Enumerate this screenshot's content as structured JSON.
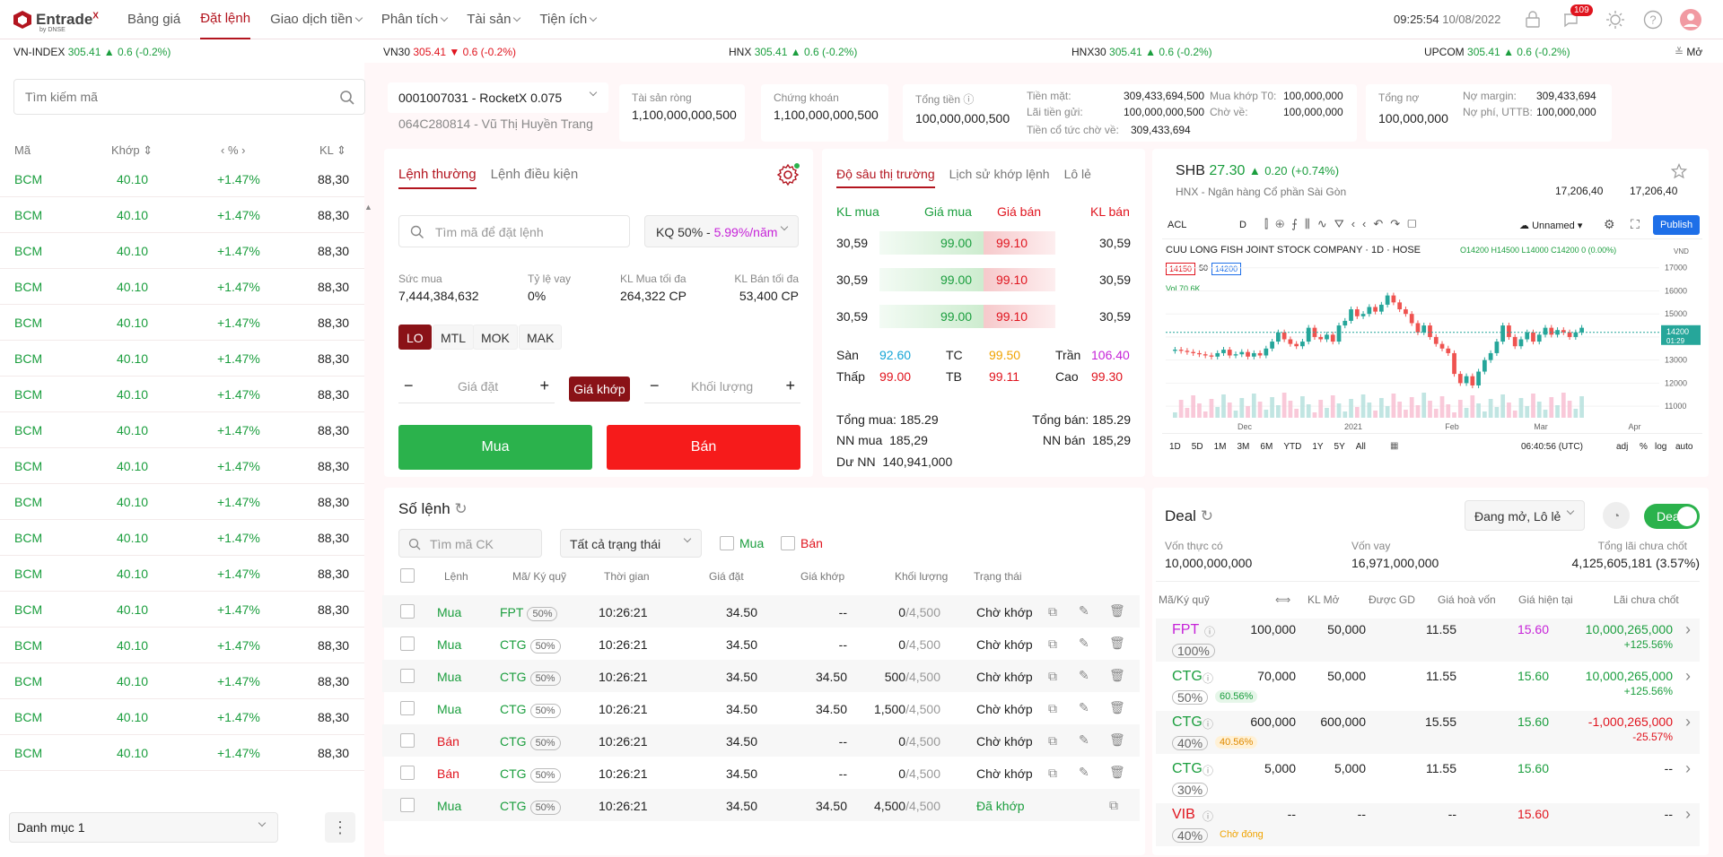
{
  "topbar": {
    "brand": "Entrade",
    "brand_sup": "X",
    "brand_sub": "by DNSE",
    "nav": [
      {
        "label": "Bảng giá",
        "active": false,
        "dropdown": false
      },
      {
        "label": "Đặt lệnh",
        "active": true,
        "dropdown": false
      },
      {
        "label": "Giao dịch tiền",
        "active": false,
        "dropdown": true
      },
      {
        "label": "Phân tích",
        "active": false,
        "dropdown": true
      },
      {
        "label": "Tài sản",
        "active": false,
        "dropdown": true
      },
      {
        "label": "Tiện ích",
        "active": false,
        "dropdown": true
      }
    ],
    "time": "09:25:54",
    "date": "10/08/2022",
    "notif_count": "109",
    "icons": [
      "otp-icon",
      "notification-icon",
      "theme-icon",
      "help-icon",
      "user-avatar-icon"
    ]
  },
  "indices": [
    {
      "name": "VN-INDEX",
      "value": "305.41",
      "change": "0.6 (-0.2%)"
    },
    {
      "name": "VN30",
      "value": "305.41",
      "change": "0.6 (-0.2%)"
    },
    {
      "name": "HNX",
      "value": "305.41",
      "change": "0.6 (-0.2%)"
    },
    {
      "name": "HNX30",
      "value": "305.41",
      "change": "0.6 (-0.2%)"
    },
    {
      "name": "UPCOM",
      "value": "305.41",
      "change": "0.6 (-0.2%)"
    }
  ],
  "indices_more": "Mở",
  "watchlist": {
    "search_placeholder": "Tìm kiếm mã",
    "columns": [
      "Mã",
      "Khớp",
      "%",
      "KL"
    ],
    "rows": [
      {
        "code": "BCM",
        "price": "40.10",
        "pct": "+1.47%",
        "vol": "88,30"
      },
      {
        "code": "BCM",
        "price": "40.10",
        "pct": "+1.47%",
        "vol": "88,30"
      },
      {
        "code": "BCM",
        "price": "40.10",
        "pct": "+1.47%",
        "vol": "88,30"
      },
      {
        "code": "BCM",
        "price": "40.10",
        "pct": "+1.47%",
        "vol": "88,30"
      },
      {
        "code": "BCM",
        "price": "40.10",
        "pct": "+1.47%",
        "vol": "88,30"
      },
      {
        "code": "BCM",
        "price": "40.10",
        "pct": "+1.47%",
        "vol": "88,30"
      },
      {
        "code": "BCM",
        "price": "40.10",
        "pct": "+1.47%",
        "vol": "88,30"
      },
      {
        "code": "BCM",
        "price": "40.10",
        "pct": "+1.47%",
        "vol": "88,30"
      },
      {
        "code": "BCM",
        "price": "40.10",
        "pct": "+1.47%",
        "vol": "88,30"
      },
      {
        "code": "BCM",
        "price": "40.10",
        "pct": "+1.47%",
        "vol": "88,30"
      },
      {
        "code": "BCM",
        "price": "40.10",
        "pct": "+1.47%",
        "vol": "88,30"
      },
      {
        "code": "BCM",
        "price": "40.10",
        "pct": "+1.47%",
        "vol": "88,30"
      },
      {
        "code": "BCM",
        "price": "40.10",
        "pct": "+1.47%",
        "vol": "88,30"
      },
      {
        "code": "BCM",
        "price": "40.10",
        "pct": "+1.47%",
        "vol": "88,30"
      },
      {
        "code": "BCM",
        "price": "40.10",
        "pct": "+1.47%",
        "vol": "88,30"
      },
      {
        "code": "BCM",
        "price": "40.10",
        "pct": "+1.47%",
        "vol": "88,30"
      },
      {
        "code": "BCM",
        "price": "40.10",
        "pct": "+1.47%",
        "vol": "88,30"
      }
    ],
    "list_name": "Danh mục 1"
  },
  "account": {
    "id": "0001007031 - RocketX 0.075",
    "sub": "064C280814 - Vũ Thị Huyền Trang",
    "tai_san_rong_label": "Tài sản ròng",
    "tai_san_rong": "1,100,000,000,500",
    "chung_khoan_label": "Chứng khoán",
    "chung_khoan": "1,100,000,000,500",
    "tong_tien_label": "Tổng tiền",
    "tong_tien": "100,000,000,500",
    "tien_mat_label": "Tiền mặt:",
    "tien_mat": "309,433,694,500",
    "lai_tien_gui_label": "Lãi tiền gửi:",
    "lai_tien_gui": "100,000,000,500",
    "tien_co_tuc_label": "Tiền cổ tức chờ về:",
    "tien_co_tuc": "309,433,694",
    "mua_khop_label": "Mua khớp T0:",
    "mua_khop": "100,000,000",
    "cho_ve_label": "Chờ về:",
    "cho_ve": "100,000,000",
    "tong_no_label": "Tổng nợ",
    "tong_no": "100,000,000",
    "no_margin_label": "Nợ margin:",
    "no_margin": "309,433,694",
    "no_phi_label": "Nợ phí, UTTB:",
    "no_phi": "100,000,000"
  },
  "order": {
    "tabs": [
      "Lệnh thường",
      "Lệnh điều kiện"
    ],
    "search_placeholder": "Tìm mã để đặt lệnh",
    "kq": "KQ 50% - ",
    "kq_rate": "5.99%/năm",
    "suc_mua_label": "Sức mua",
    "suc_mua": "7,444,384,632",
    "ty_le_vay_label": "Tỷ lệ vay",
    "ty_le_vay": "0%",
    "kl_mua_label": "KL Mua tối đa",
    "kl_mua": "264,322 CP",
    "kl_ban_label": "KL Bán tối đa",
    "kl_ban": "53,400 CP",
    "types": [
      "LO",
      "MTL",
      "MOK",
      "MAK"
    ],
    "price_placeholder": "Giá đặt",
    "gia_khop": "Giá khớp",
    "qty_placeholder": "Khối lượng",
    "buy": "Mua",
    "sell": "Bán"
  },
  "depth": {
    "tabs": [
      "Độ sâu thị trường",
      "Lịch sử khớp lệnh",
      "Lô lẻ"
    ],
    "headers": [
      "KL mua",
      "Giá mua",
      "Giá bán",
      "KL bán"
    ],
    "rows": [
      {
        "kl_mua": "30,59",
        "gia_mua": "99.00",
        "gia_ban": "99.10",
        "kl_ban": "30,59"
      },
      {
        "kl_mua": "30,59",
        "gia_mua": "99.00",
        "gia_ban": "99.10",
        "kl_ban": "30,59"
      },
      {
        "kl_mua": "30,59",
        "gia_mua": "99.00",
        "gia_ban": "99.10",
        "kl_ban": "30,59"
      }
    ],
    "san_label": "Sàn",
    "san": "92.60",
    "tc_label": "TC",
    "tc": "99.50",
    "tran_label": "Trần",
    "tran": "106.40",
    "thap_label": "Thấp",
    "thap": "99.00",
    "tb_label": "TB",
    "tb": "99.11",
    "cao_label": "Cao",
    "cao": "99.30",
    "tong_mua": "Tổng mua: 185.29",
    "tong_ban": "Tổng bán: 185.29",
    "nn_mua": "NN mua  185,29",
    "nn_ban": "NN bán  185,29",
    "du_nn": "Dư NN  140,941,000"
  },
  "stock": {
    "code": "SHB",
    "price": "27.30",
    "change": "0.20",
    "pct": "(+0.74%)",
    "name": "HNX - Ngân hàng Cổ phần Sài Gòn",
    "v1": "17,206,40",
    "v2": "17,206,40"
  },
  "chart": {
    "toolbar": [
      "ACL",
      "D",
      "Unnamed",
      "Publish"
    ],
    "title": "CUU LONG FISH JOINT STOCK COMPANY · 1D · HOSE",
    "ohlc": "O14200 H14500 L14000 C14200 0 (0.00%)",
    "tags": [
      "14150",
      "50",
      "14200"
    ],
    "vol": "Vol  70.6K",
    "ranges": [
      "1D",
      "5D",
      "1M",
      "3M",
      "6M",
      "YTD",
      "1Y",
      "5Y",
      "All"
    ],
    "time": "06:40:56 (UTC)",
    "opts": [
      "adj",
      "%",
      "log",
      "auto"
    ],
    "months": [
      "Dec",
      "2021",
      "Feb",
      "Mar",
      "Apr"
    ],
    "price_last": "14200",
    "countdown": "01:29"
  },
  "chart_data": {
    "type": "candlestick",
    "x_ticks": [
      "Dec",
      "2021",
      "Feb",
      "Mar",
      "Apr"
    ],
    "y_ticks": [
      17000,
      16000,
      15000,
      14000,
      13000,
      12000,
      11000
    ],
    "ylim": [
      10500,
      17300
    ],
    "last": 14200,
    "unit": "VND",
    "closes": [
      13450,
      13400,
      13350,
      13300,
      13250,
      13200,
      13150,
      13300,
      13450,
      13200,
      13250,
      13350,
      13150,
      13300,
      13200,
      13500,
      13800,
      14200,
      13900,
      13700,
      13600,
      13800,
      14400,
      14000,
      13900,
      14100,
      13800,
      14500,
      14700,
      15200,
      14900,
      15000,
      15300,
      15100,
      15400,
      15800,
      15500,
      15200,
      15000,
      14600,
      14200,
      14500,
      14000,
      13700,
      13500,
      13300,
      12400,
      12000,
      12300,
      11900,
      12500,
      13000,
      13300,
      13800,
      14500,
      14000,
      13600,
      13900,
      14200,
      13800,
      14100,
      14400,
      14100,
      14300,
      14200,
      14000,
      14200,
      14400
    ]
  },
  "orders": {
    "title": "Số lệnh",
    "search_placeholder": "Tìm mã CK",
    "status_filter": "Tất cả trạng thái",
    "buy_filter": "Mua",
    "sell_filter": "Bán",
    "columns": [
      "Lệnh",
      "Mã/ Ký quỹ",
      "Thời gian",
      "Giá đặt",
      "Giá khớp",
      "Khối lượng",
      "Trạng thái"
    ],
    "rows": [
      {
        "side": "Mua",
        "code": "FPT",
        "margin": "50%",
        "time": "10:26:21",
        "price": "34.50",
        "matched": "--",
        "qty": "0",
        "total": "/4,500",
        "status": "Chờ khớp"
      },
      {
        "side": "Mua",
        "code": "CTG",
        "margin": "50%",
        "time": "10:26:21",
        "price": "34.50",
        "matched": "--",
        "qty": "0",
        "total": "/4,500",
        "status": "Chờ khớp"
      },
      {
        "side": "Mua",
        "code": "CTG",
        "margin": "50%",
        "time": "10:26:21",
        "price": "34.50",
        "matched": "34.50",
        "qty": "500",
        "total": "/4,500",
        "status": "Chờ khớp"
      },
      {
        "side": "Mua",
        "code": "CTG",
        "margin": "50%",
        "time": "10:26:21",
        "price": "34.50",
        "matched": "34.50",
        "qty": "1,500",
        "total": "/4,500",
        "status": "Chờ khớp"
      },
      {
        "side": "Bán",
        "code": "CTG",
        "margin": "50%",
        "time": "10:26:21",
        "price": "34.50",
        "matched": "--",
        "qty": "0",
        "total": "/4,500",
        "status": "Chờ khớp"
      },
      {
        "side": "Bán",
        "code": "CTG",
        "margin": "50%",
        "time": "10:26:21",
        "price": "34.50",
        "matched": "--",
        "qty": "0",
        "total": "/4,500",
        "status": "Chờ khớp"
      },
      {
        "side": "Mua",
        "code": "CTG",
        "margin": "50%",
        "time": "10:26:21",
        "price": "34.50",
        "matched": "34.50",
        "qty": "4,500",
        "total": "/4,500",
        "status": "Đã khớp"
      }
    ]
  },
  "deal": {
    "title": "Deal",
    "filter": "Đang mở, Lô lẻ",
    "toggle": "Deal",
    "von_thuc_co_label": "Vốn thực có",
    "von_thuc_co": "10,000,000,000",
    "von_vay_label": "Vốn vay",
    "von_vay": "16,971,000,000",
    "tong_lai_label": "Tổng lãi chưa chốt",
    "tong_lai": "4,125,605,181 (3.57%)",
    "columns": [
      "Mã/Ký quỹ",
      "KL Mở",
      "Được GD",
      "Giá hoà vốn",
      "Giá hiện tại",
      "Lãi chưa chốt"
    ],
    "rows": [
      {
        "code": "FPT",
        "margin": "100%",
        "badge": "",
        "kl": "100,000",
        "gd": "50,000",
        "hv": "11.55",
        "cur": "15.60",
        "pl": "10,000,265,000",
        "plp": "+125.56%"
      },
      {
        "code": "CTG",
        "margin": "50%",
        "badge": "60.56%",
        "kl": "70,000",
        "gd": "50,000",
        "hv": "11.55",
        "cur": "15.60",
        "pl": "10,000,265,000",
        "plp": "+125.56%"
      },
      {
        "code": "CTG",
        "margin": "40%",
        "badge": "40.56%",
        "kl": "600,000",
        "gd": "600,000",
        "hv": "15.55",
        "cur": "15.60",
        "pl": "-1,000,265,000",
        "plp": "-25.57%"
      },
      {
        "code": "CTG",
        "margin": "30%",
        "badge": "",
        "kl": "5,000",
        "gd": "5,000",
        "hv": "11.55",
        "cur": "15.60",
        "pl": "--",
        "plp": ""
      },
      {
        "code": "VIB",
        "margin": "40%",
        "badge": "Chờ đóng",
        "kl": "--",
        "gd": "--",
        "hv": "--",
        "cur": "15.60",
        "pl": "--",
        "plp": ""
      }
    ]
  }
}
